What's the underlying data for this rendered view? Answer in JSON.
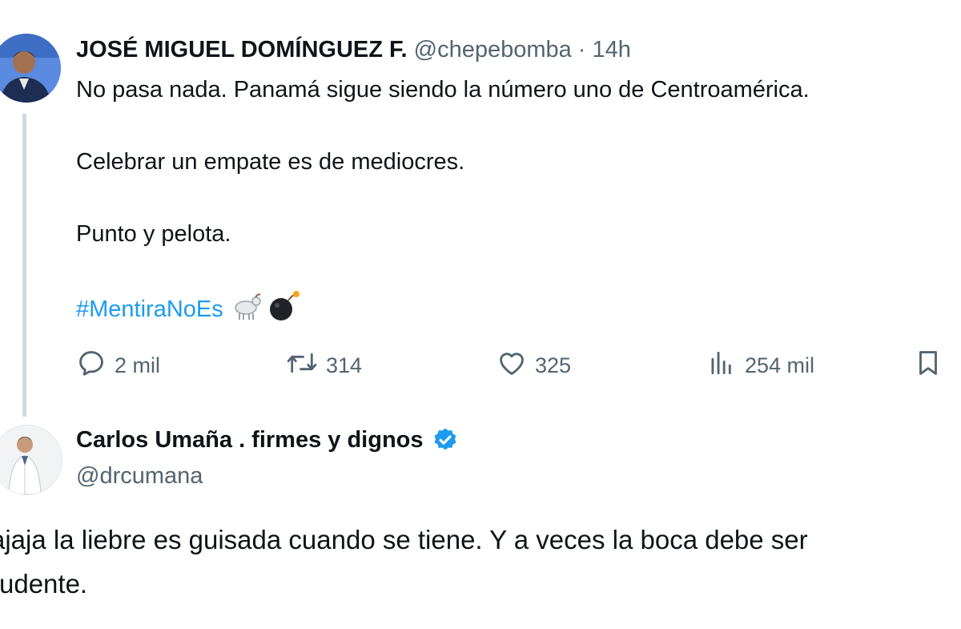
{
  "tweet1": {
    "author_name": "JOSÉ MIGUEL DOMÍNGUEZ F.",
    "handle_time": "@chepebomba · 14h",
    "line1": "No pasa nada. Panamá sigue siendo la número uno de Centroamérica.",
    "line2": "Celebrar un empate es de mediocres.",
    "line3": "Punto y pelota.",
    "hashtag": "#MentiraNoEs",
    "emojis": [
      "goat-emoji",
      "bomb-emoji"
    ],
    "actions": {
      "replies": "2 mil",
      "reposts": "314",
      "likes": "325",
      "views": "254 mil"
    }
  },
  "tweet2": {
    "author_name": "Carlos Umaña . firmes y dignos",
    "verified": true,
    "handle": "@drcumana",
    "text_line1": "ajaja la liebre es guisada cuando se tiene. Y a veces la boca debe ser",
    "text_line2": "rudente."
  },
  "colors": {
    "accent": "#1d9bf0",
    "muted": "#536471",
    "text": "#0f1419",
    "thread_line": "#cfd9de"
  }
}
